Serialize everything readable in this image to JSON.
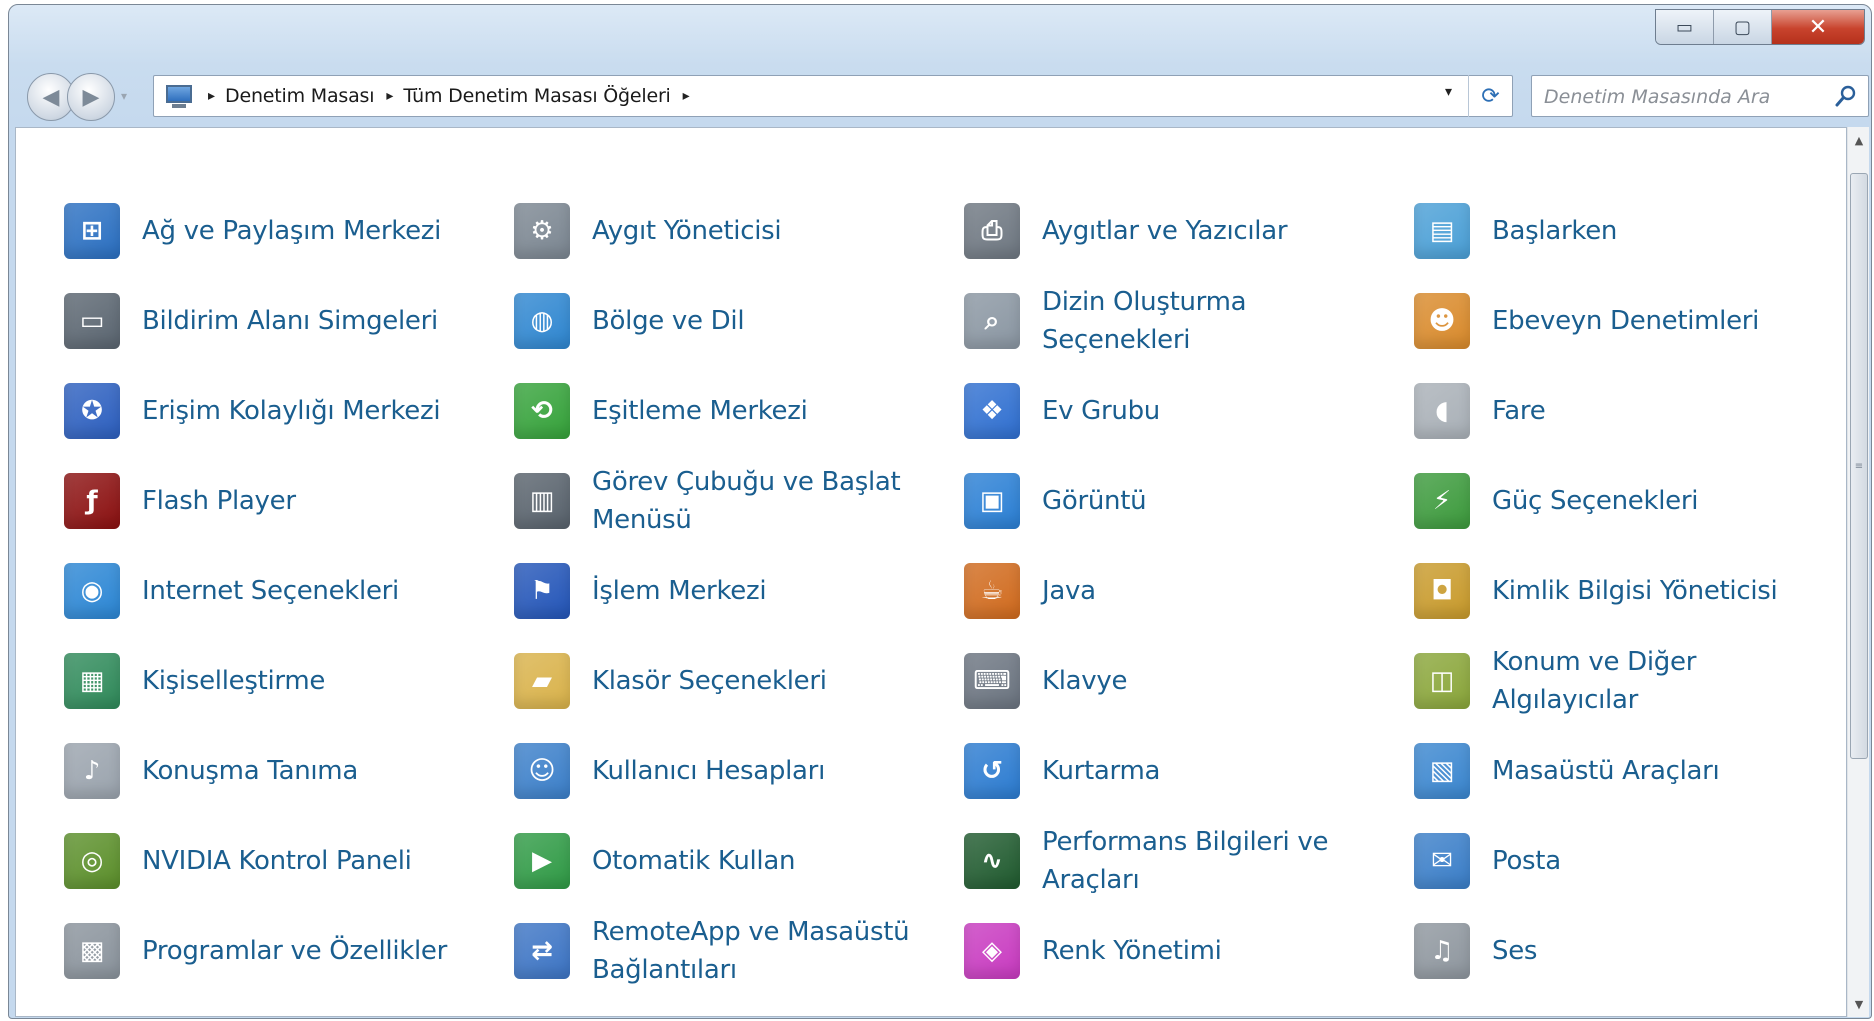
{
  "window": {
    "minimize_glyph": "▭",
    "maximize_glyph": "▢",
    "close_glyph": "✕"
  },
  "nav": {
    "back_glyph": "◀",
    "forward_glyph": "▶",
    "recent_glyph": "▾"
  },
  "address": {
    "breadcrumbs": [
      "Denetim Masası",
      "Tüm Denetim Masası Öğeleri"
    ],
    "separator": "▸",
    "dropdown_glyph": "▾",
    "refresh_glyph": "⟳"
  },
  "search": {
    "placeholder": "Denetim Masasında Ara"
  },
  "scrollbar": {
    "up": "▲",
    "down": "▼",
    "grip": "≡"
  },
  "items": [
    {
      "label": "Ağ ve Paylaşım Merkezi",
      "icon": "network-icon",
      "glyph": "⊞",
      "color": "#2a6fc1"
    },
    {
      "label": "Aygıt Yöneticisi",
      "icon": "device-manager-icon",
      "glyph": "⚙",
      "color": "#7b8691"
    },
    {
      "label": "Aygıtlar ve Yazıcılar",
      "icon": "printer-icon",
      "glyph": "⎙",
      "color": "#6e7781"
    },
    {
      "label": "Başlarken",
      "icon": "getting-started-icon",
      "glyph": "▤",
      "color": "#4a9fd6"
    },
    {
      "label": "Bildirim Alanı Simgeleri",
      "icon": "notification-icon",
      "glyph": "▭",
      "color": "#5a6570"
    },
    {
      "label": "Bölge ve Dil",
      "icon": "globe-clock-icon",
      "glyph": "◍",
      "color": "#2e86d0"
    },
    {
      "label": "Dizin Oluşturma Seçenekleri",
      "icon": "indexing-icon",
      "glyph": "⌕",
      "color": "#8a96a2"
    },
    {
      "label": "Ebeveyn Denetimleri",
      "icon": "parental-controls-icon",
      "glyph": "☻",
      "color": "#d98a2b"
    },
    {
      "label": "Erişim Kolaylığı Merkezi",
      "icon": "accessibility-icon",
      "glyph": "✪",
      "color": "#2c5fbf"
    },
    {
      "label": "Eşitleme Merkezi",
      "icon": "sync-icon",
      "glyph": "⟲",
      "color": "#35a23a"
    },
    {
      "label": "Ev Grubu",
      "icon": "homegroup-icon",
      "glyph": "❖",
      "color": "#2f6fd0"
    },
    {
      "label": "Fare",
      "icon": "mouse-icon",
      "glyph": "◖",
      "color": "#a9b0b7"
    },
    {
      "label": "Flash Player",
      "icon": "flash-icon",
      "glyph": "ƒ",
      "color": "#8b1010"
    },
    {
      "label": "Görev Çubuğu ve Başlat Menüsü",
      "icon": "taskbar-icon",
      "glyph": "▥",
      "color": "#58626c"
    },
    {
      "label": "Görüntü",
      "icon": "display-icon",
      "glyph": "▣",
      "color": "#2a7fd4"
    },
    {
      "label": "Güç Seçenekleri",
      "icon": "power-icon",
      "glyph": "⚡",
      "color": "#3c9a3c"
    },
    {
      "label": "Internet Seçenekleri",
      "icon": "internet-options-icon",
      "glyph": "◉",
      "color": "#2b86d4"
    },
    {
      "label": "İşlem Merkezi",
      "icon": "action-center-flag-icon",
      "glyph": "⚑",
      "color": "#2355b8"
    },
    {
      "label": "Java",
      "icon": "java-icon",
      "glyph": "☕",
      "color": "#d06a1d"
    },
    {
      "label": "Kimlik Bilgisi Yöneticisi",
      "icon": "credential-manager-icon",
      "glyph": "◘",
      "color": "#c89a2b"
    },
    {
      "label": "Kişiselleştirme",
      "icon": "personalization-icon",
      "glyph": "▦",
      "color": "#2f8a5a"
    },
    {
      "label": "Klasör Seçenekleri",
      "icon": "folder-options-icon",
      "glyph": "▰",
      "color": "#d9b24a"
    },
    {
      "label": "Klavye",
      "icon": "keyboard-icon",
      "glyph": "⌨",
      "color": "#6b7480"
    },
    {
      "label": "Konum ve Diğer Algılayıcılar",
      "icon": "location-sensors-icon",
      "glyph": "◫",
      "color": "#8aa63a"
    },
    {
      "label": "Konuşma Tanıma",
      "icon": "microphone-icon",
      "glyph": "♪",
      "color": "#9aa3ad"
    },
    {
      "label": "Kullanıcı Hesapları",
      "icon": "user-accounts-icon",
      "glyph": "☺",
      "color": "#3b7fc9"
    },
    {
      "label": "Kurtarma",
      "icon": "recovery-icon",
      "glyph": "↺",
      "color": "#2b7bd0"
    },
    {
      "label": "Masaüstü Araçları",
      "icon": "desktop-gadgets-icon",
      "glyph": "▧",
      "color": "#3a86cf"
    },
    {
      "label": "NVIDIA Kontrol Paneli",
      "icon": "nvidia-icon",
      "glyph": "◎",
      "color": "#5b8f2a"
    },
    {
      "label": "Otomatik Kullan",
      "icon": "autoplay-icon",
      "glyph": "▶",
      "color": "#2f9a45"
    },
    {
      "label": "Performans Bilgileri ve Araçları",
      "icon": "performance-icon",
      "glyph": "∿",
      "color": "#1f5a2e"
    },
    {
      "label": "Posta",
      "icon": "mail-icon",
      "glyph": "✉",
      "color": "#3a7ec8"
    },
    {
      "label": "Programlar ve Özellikler",
      "icon": "programs-features-icon",
      "glyph": "▩",
      "color": "#8a939c"
    },
    {
      "label": "RemoteApp ve Masaüstü Bağlantıları",
      "icon": "remoteapp-icon",
      "glyph": "⇄",
      "color": "#3c74c4"
    },
    {
      "label": "Renk Yönetimi",
      "icon": "color-management-icon",
      "glyph": "◈",
      "color": "#c83ac0"
    },
    {
      "label": "Ses",
      "icon": "sound-icon",
      "glyph": "♫",
      "color": "#8e969e"
    }
  ]
}
